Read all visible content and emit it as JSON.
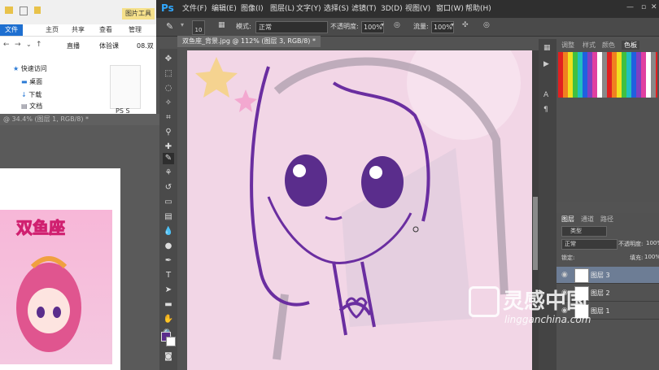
{
  "explorer": {
    "title_tab": "图片工具",
    "ribbon_tabs": [
      "文件",
      "主页",
      "共享",
      "查看",
      "管理"
    ],
    "address": [
      "直播",
      "体验课",
      "08.双"
    ],
    "nav_items": [
      "快速访问",
      "桌面",
      "下载",
      "文档"
    ],
    "file_label": "PS S"
  },
  "ps": {
    "logo": "Ps",
    "menu": [
      "文件(F)",
      "编辑(E)",
      "图像(I)",
      "图层(L)",
      "文字(Y)",
      "选择(S)",
      "滤镜(T)",
      "3D(D)",
      "视图(V)",
      "窗口(W)",
      "帮助(H)"
    ],
    "options": {
      "brush_size": "10",
      "mode_label": "模式:",
      "mode_value": "正常",
      "opacity_label": "不透明度:",
      "opacity_value": "100%",
      "flow_label": "流量:",
      "flow_value": "100%"
    },
    "doc_tab": "双鱼座_背景.jpg @ 112% (图层 3, RGB/8) *",
    "doc2_tab": "@ 34.4% (图层 1, RGB/8) *",
    "swatch_tabs": [
      "调整",
      "样式",
      "颜色",
      "色板"
    ],
    "layers": {
      "tabs": [
        "图层",
        "通道",
        "路径"
      ],
      "filter_label": "类型",
      "blend_mode": "正常",
      "opacity_label": "不透明度:",
      "opacity_value": "100%",
      "lock_label": "锁定:",
      "fill_label": "填充:",
      "fill_value": "100%",
      "items": [
        "图层 3",
        "图层 2",
        "图层 1"
      ]
    },
    "foreground_color": "#5a2d8c",
    "artwork_title": "双鱼座"
  },
  "watermark": {
    "cn": "灵感中国",
    "url": "lingganchina.com"
  }
}
